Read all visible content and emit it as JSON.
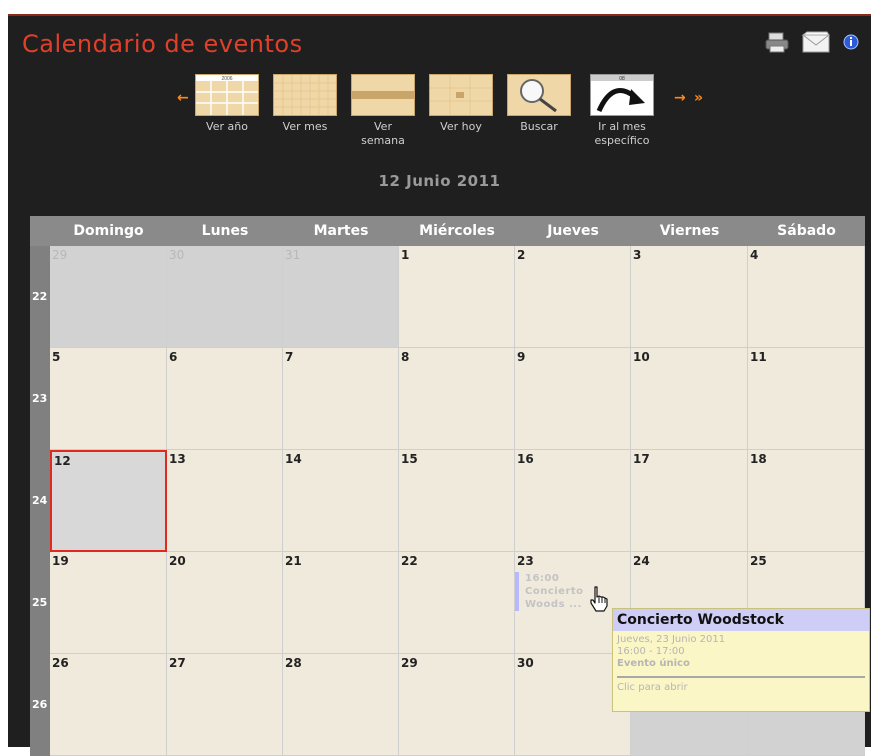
{
  "header": {
    "title": "Calendario de eventos"
  },
  "nav": {
    "items": [
      {
        "label": "Ver año",
        "thumb_text": "2006"
      },
      {
        "label": "Ver mes"
      },
      {
        "label": "Ver semana"
      },
      {
        "label": "Ver hoy"
      },
      {
        "label": "Buscar"
      },
      {
        "label": "Ir al mes específico",
        "thumb_text": "08"
      }
    ],
    "prev_arrow": "←",
    "next_arrow": "→",
    "fast_forward": "»"
  },
  "current_date": "12 Junio 2011",
  "weekdays": [
    "Domingo",
    "Lunes",
    "Martes",
    "Miércoles",
    "Jueves",
    "Viernes",
    "Sábado"
  ],
  "weeks": [
    {
      "week": "22",
      "days": [
        "29",
        "30",
        "31",
        "1",
        "2",
        "3",
        "4"
      ]
    },
    {
      "week": "23",
      "days": [
        "5",
        "6",
        "7",
        "8",
        "9",
        "10",
        "11"
      ]
    },
    {
      "week": "24",
      "days": [
        "12",
        "13",
        "14",
        "15",
        "16",
        "17",
        "18"
      ]
    },
    {
      "week": "25",
      "days": [
        "19",
        "20",
        "21",
        "22",
        "23",
        "24",
        "25"
      ]
    },
    {
      "week": "26",
      "days": [
        "26",
        "27",
        "28",
        "29",
        "30",
        "",
        ""
      ]
    }
  ],
  "event_preview": {
    "line1": "16:00",
    "line2": "Concierto",
    "line3": "Woods ..."
  },
  "tooltip": {
    "title": "Concierto Woodstock",
    "date": "Jueves, 23 Junio 2011",
    "time": "16:00 - 17:00",
    "type": "Evento único",
    "action": "Clic para abrir"
  },
  "colors": {
    "accent": "#e0402a",
    "background": "#1f1f1f",
    "cell": "#efeadb",
    "other_month": "#d2d2d2",
    "today_border": "#e3281e",
    "tooltip_bg": "#fbf6c6",
    "tooltip_head": "#cdcdf6"
  }
}
